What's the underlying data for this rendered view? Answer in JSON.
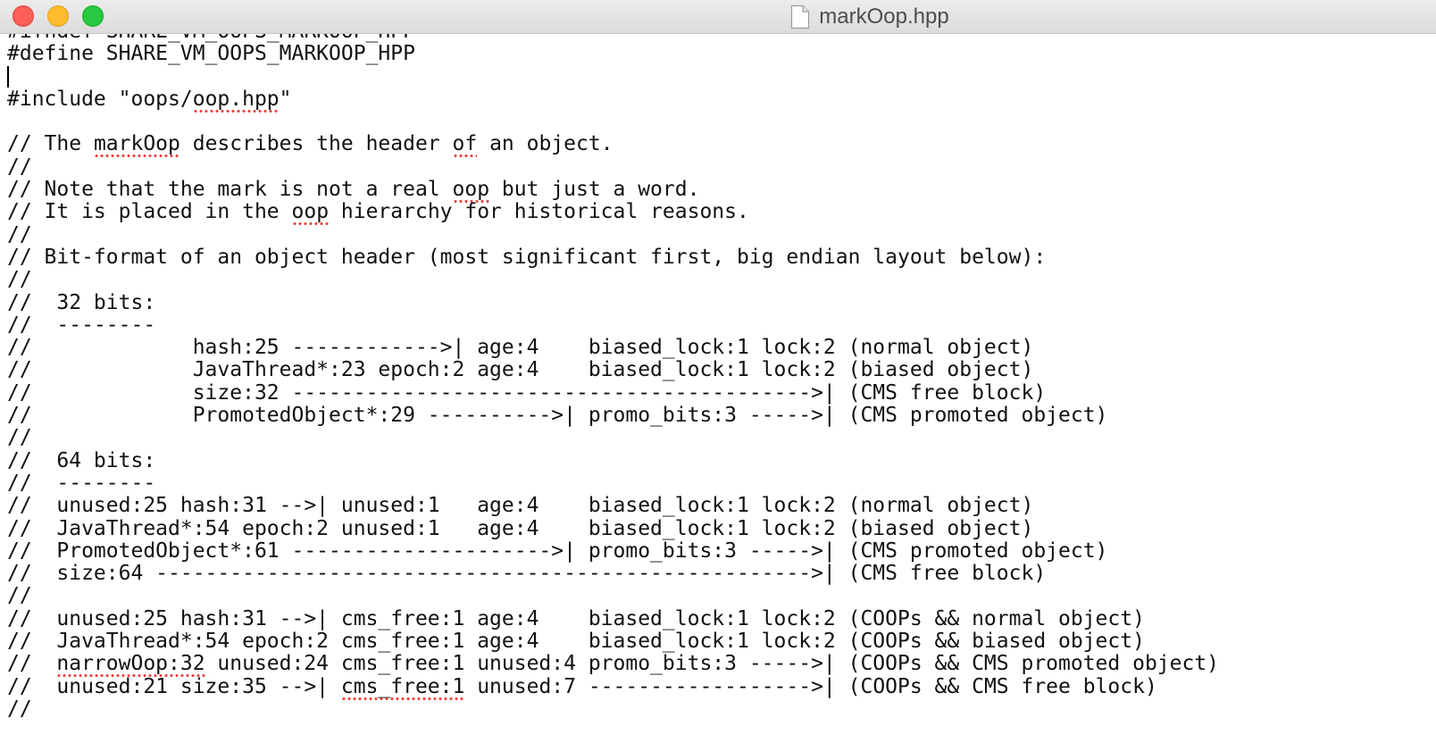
{
  "window": {
    "title": "markOop.hpp",
    "controls": {
      "close_color": "#fe5f57",
      "minimize_color": "#febc2e",
      "zoom_color": "#28c840"
    }
  },
  "spellcheck_underline_color": "#e8403a",
  "editor": {
    "lines": [
      [
        {
          "t": "#ifndef SHARE_VM_OOPS_MARKOOP_HPP"
        }
      ],
      [
        {
          "t": "#define SHARE_VM_OOPS_MARKOOP_HPP"
        }
      ],
      [],
      [
        {
          "t": "#include \"oops/"
        },
        {
          "t": "oop.hpp",
          "s": true
        },
        {
          "t": "\""
        }
      ],
      [],
      [
        {
          "t": "// The "
        },
        {
          "t": "markOop",
          "s": true
        },
        {
          "t": " describes the header "
        },
        {
          "t": "of",
          "s": true
        },
        {
          "t": " an object."
        }
      ],
      [
        {
          "t": "//"
        }
      ],
      [
        {
          "t": "// Note that the mark is not a real "
        },
        {
          "t": "oop",
          "s": true
        },
        {
          "t": " but just a word."
        }
      ],
      [
        {
          "t": "// It is placed in the "
        },
        {
          "t": "oop",
          "s": true
        },
        {
          "t": " hierarchy for historical reasons."
        }
      ],
      [
        {
          "t": "//"
        }
      ],
      [
        {
          "t": "// Bit-format of an object header (most significant first, big endian layout below):"
        }
      ],
      [
        {
          "t": "//"
        }
      ],
      [
        {
          "t": "//  32 bits:"
        }
      ],
      [
        {
          "t": "//  --------"
        }
      ],
      [
        {
          "t": "//             hash:25 ------------>| age:4    biased_lock:1 lock:2 (normal object)"
        }
      ],
      [
        {
          "t": "//             JavaThread*:23 epoch:2 age:4    biased_lock:1 lock:2 (biased object)"
        }
      ],
      [
        {
          "t": "//             size:32 ------------------------------------------>| (CMS free block)"
        }
      ],
      [
        {
          "t": "//             PromotedObject*:29 ---------->| promo_bits:3 ----->| (CMS promoted object)"
        }
      ],
      [
        {
          "t": "//"
        }
      ],
      [
        {
          "t": "//  64 bits:"
        }
      ],
      [
        {
          "t": "//  --------"
        }
      ],
      [
        {
          "t": "//  unused:25 hash:31 -->| unused:1   age:4    biased_lock:1 lock:2 (normal object)"
        }
      ],
      [
        {
          "t": "//  JavaThread*:54 epoch:2 unused:1   age:4    biased_lock:1 lock:2 (biased object)"
        }
      ],
      [
        {
          "t": "//  PromotedObject*:61 --------------------->| promo_bits:3 ----->| (CMS promoted object)"
        }
      ],
      [
        {
          "t": "//  size:64 ----------------------------------------------------->| (CMS free block)"
        }
      ],
      [
        {
          "t": "//"
        }
      ],
      [
        {
          "t": "//  unused:25 hash:31 -->| cms_free:1 age:4    biased_lock:1 lock:2 (COOPs && normal object)"
        }
      ],
      [
        {
          "t": "//  JavaThread*:54 epoch:2 cms_free:1 age:4    biased_lock:1 lock:2 (COOPs && biased object)"
        }
      ],
      [
        {
          "t": "//  "
        },
        {
          "t": "narrowOop:32",
          "s": true
        },
        {
          "t": " unused:24 cms_free:1 unused:4 promo_bits:3 ----->| (COOPs && CMS promoted object)"
        }
      ],
      [
        {
          "t": "//  unused:21 size:35 -->| "
        },
        {
          "t": "cms_free:1",
          "s": true
        },
        {
          "t": " unused:7 ------------------>| (COOPs && CMS free block)"
        }
      ],
      [
        {
          "t": "//"
        }
      ]
    ]
  }
}
